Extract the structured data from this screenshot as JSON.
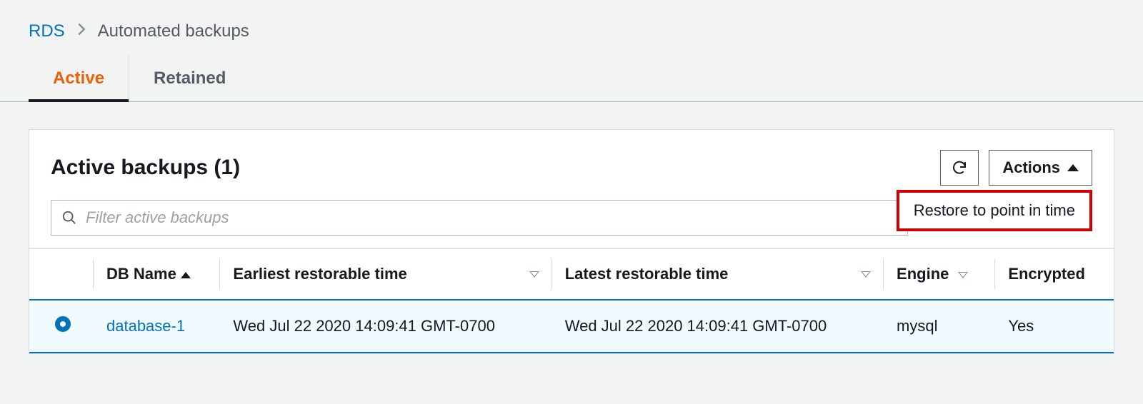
{
  "breadcrumb": {
    "root": "RDS",
    "current": "Automated backups"
  },
  "tabs": {
    "active": "Active",
    "retained": "Retained"
  },
  "panel": {
    "title": "Active backups (1)",
    "actions_label": "Actions",
    "menu_item": "Restore to point in time",
    "filter_placeholder": "Filter active backups"
  },
  "columns": {
    "db_name": "DB Name",
    "earliest": "Earliest restorable time",
    "latest": "Latest restorable time",
    "engine": "Engine",
    "encrypted": "Encrypted"
  },
  "rows": [
    {
      "db_name": "database-1",
      "earliest": "Wed Jul 22 2020 14:09:41 GMT-0700",
      "latest": "Wed Jul 22 2020 14:09:41 GMT-0700",
      "engine": "mysql",
      "encrypted": "Yes"
    }
  ]
}
